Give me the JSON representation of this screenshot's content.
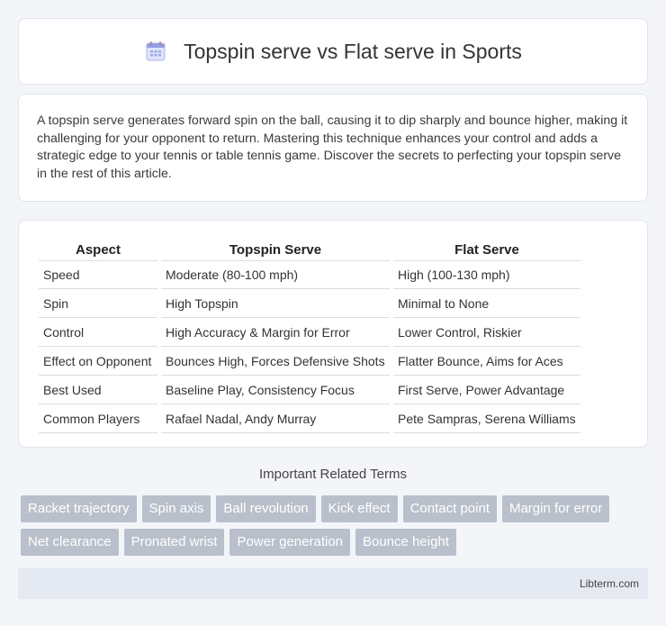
{
  "header": {
    "title": "Topspin serve vs Flat serve in Sports",
    "icon": "calendar-icon"
  },
  "intro": {
    "text": "A topspin serve generates forward spin on the ball, causing it to dip sharply and bounce higher, making it challenging for your opponent to return. Mastering this technique enhances your control and adds a strategic edge to your tennis or table tennis game. Discover the secrets to perfecting your topspin serve in the rest of this article."
  },
  "table": {
    "headers": [
      "Aspect",
      "Topspin Serve",
      "Flat Serve"
    ],
    "rows": [
      [
        "Speed",
        "Moderate (80-100 mph)",
        "High (100-130 mph)"
      ],
      [
        "Spin",
        "High Topspin",
        "Minimal to None"
      ],
      [
        "Control",
        "High Accuracy & Margin for Error",
        "Lower Control, Riskier"
      ],
      [
        "Effect on Opponent",
        "Bounces High, Forces Defensive Shots",
        "Flatter Bounce, Aims for Aces"
      ],
      [
        "Best Used",
        "Baseline Play, Consistency Focus",
        "First Serve, Power Advantage"
      ],
      [
        "Common Players",
        "Rafael Nadal, Andy Murray",
        "Pete Sampras, Serena Williams"
      ]
    ]
  },
  "terms": {
    "title": "Important Related Terms",
    "items": [
      "Racket trajectory",
      "Spin axis",
      "Ball revolution",
      "Kick effect",
      "Contact point",
      "Margin for error",
      "Net clearance",
      "Pronated wrist",
      "Power generation",
      "Bounce height"
    ]
  },
  "footer": {
    "site": "Libterm.com"
  },
  "colors": {
    "tag_bg": "#b9c0cb",
    "footer_bg": "#e4e9f2",
    "icon_accent": "#7b8fe0"
  }
}
